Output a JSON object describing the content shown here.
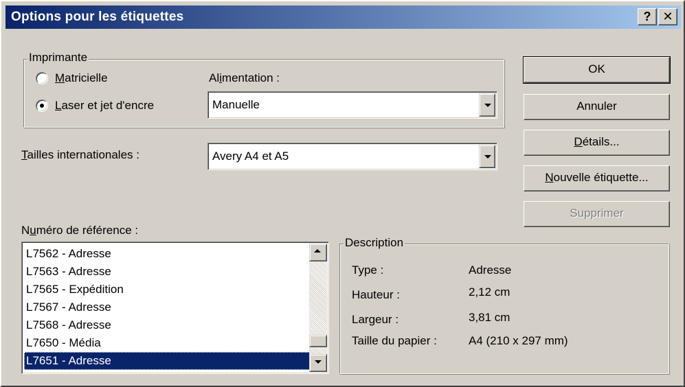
{
  "window": {
    "title": "Options pour les étiquettes",
    "help_button": "?",
    "close_button": "✕"
  },
  "printer_group": {
    "legend": "Imprimante",
    "options": [
      {
        "label": "Matricielle",
        "accesskey": "M",
        "rest": "atricielle",
        "selected": false
      },
      {
        "label": "Laser et jet d'encre",
        "accesskey": "L",
        "rest": "aser et jet d'encre",
        "selected": true
      }
    ],
    "feed_label_pre": "Al",
    "feed_label_key": "i",
    "feed_label_post": "mentation :",
    "feed_value": "Manuelle"
  },
  "sizes": {
    "label_key": "T",
    "label_rest": "ailles internationales :",
    "value": "Avery A4 et A5"
  },
  "reference": {
    "label_pre": "N",
    "label_key": "u",
    "label_post": "méro de référence :",
    "items": [
      "L7562 - Adresse",
      "L7563 - Adresse",
      "L7565 - Expédition",
      "L7567 - Adresse",
      "L7568 - Adresse",
      "L7650 - Média",
      "L7651 - Adresse"
    ],
    "selected_index": 6
  },
  "description": {
    "legend": "Description",
    "rows": [
      {
        "key": "Type :",
        "value": "Adresse"
      },
      {
        "key": "Hauteur :",
        "value": "2,12 cm"
      },
      {
        "key": "Largeur :",
        "value": "3,81 cm"
      },
      {
        "key": "Taille du papier :",
        "value": "A4 (210 x 297 mm)"
      }
    ]
  },
  "buttons": {
    "ok": "OK",
    "cancel": "Annuler",
    "details_key": "D",
    "details_rest": "étails...",
    "new_key": "N",
    "new_rest": "ouvelle étiquette...",
    "delete": "Supprimer"
  },
  "colors": {
    "face": "#d4d0c8",
    "title_start": "#0a246a",
    "title_end": "#a6caf0",
    "selection": "#0a246a"
  }
}
